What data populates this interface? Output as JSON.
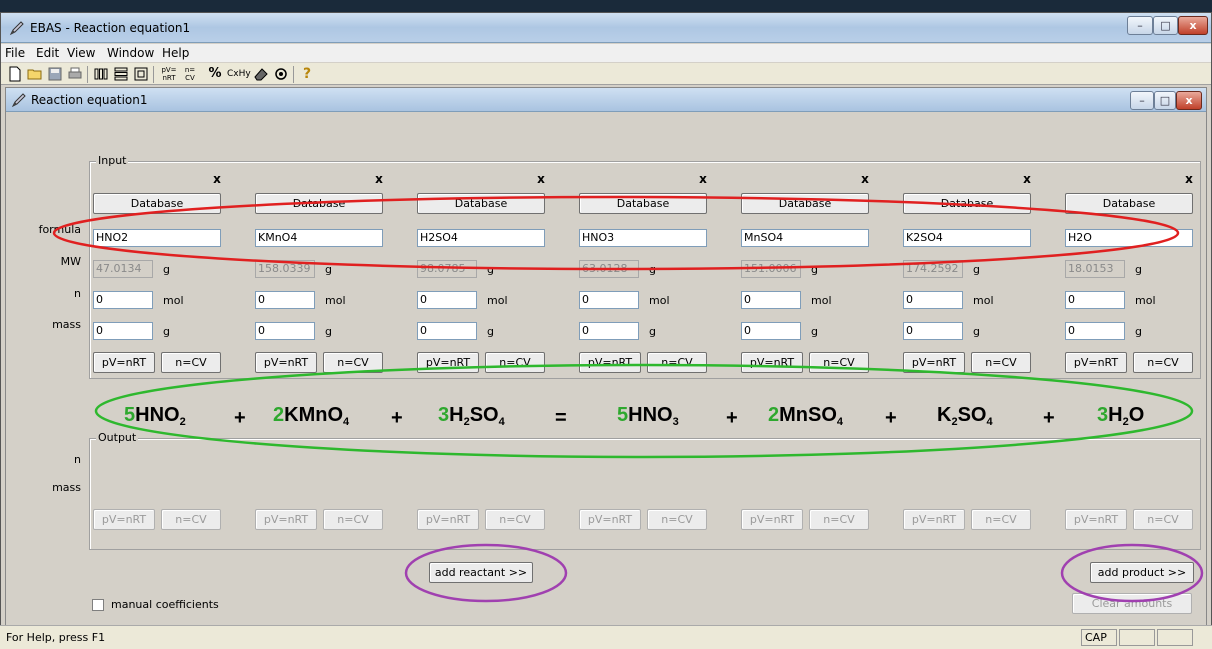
{
  "window": {
    "title": "EBAS - Reaction equation1"
  },
  "menu": [
    "File",
    "Edit",
    "View",
    "Window",
    "Help"
  ],
  "toolbar_icons": [
    "new-file-icon",
    "open-folder-icon",
    "save-icon",
    "print-icon",
    "columns-icon",
    "rows-icon",
    "window-icon",
    "pv-nrt-icon",
    "n-cv-icon",
    "percent-icon",
    "cxhy-icon",
    "eraser-icon",
    "gear-icon",
    "help-icon"
  ],
  "toolbar_text": {
    "pvnrt": "pV= nRT",
    "ncv": "n= CV",
    "percent": "%",
    "cxhy": "CxHy",
    "help": "?"
  },
  "child": {
    "title": "Reaction equation1"
  },
  "input": {
    "label": "Input",
    "row_labels": {
      "formula": "formula",
      "mw": "MW",
      "n": "n",
      "mass": "mass"
    },
    "db_label": "Database",
    "x_label": "x",
    "unit_g": "g",
    "unit_mol": "mol",
    "btn_pv": "pV=nRT",
    "btn_ncv": "n=CV",
    "columns": [
      {
        "formula": "HNO2",
        "mw": "47.0134",
        "n": "0",
        "mass": "0"
      },
      {
        "formula": "KMnO4",
        "mw": "158.0339",
        "n": "0",
        "mass": "0"
      },
      {
        "formula": "H2SO4",
        "mw": "98.0785",
        "n": "0",
        "mass": "0"
      },
      {
        "formula": "HNO3",
        "mw": "63.0128",
        "n": "0",
        "mass": "0"
      },
      {
        "formula": "MnSO4",
        "mw": "151.0006",
        "n": "0",
        "mass": "0"
      },
      {
        "formula": "K2SO4",
        "mw": "174.2592",
        "n": "0",
        "mass": "0"
      },
      {
        "formula": "H2O",
        "mw": "18.0153",
        "n": "0",
        "mass": "0"
      }
    ]
  },
  "equation": {
    "terms": [
      {
        "coef": "5",
        "parts": [
          "HNO",
          "2"
        ]
      },
      {
        "coef": "2",
        "parts": [
          "KMnO",
          "4"
        ]
      },
      {
        "coef": "3",
        "parts": [
          "H",
          "2",
          "SO",
          "4"
        ]
      },
      {
        "coef": "5",
        "parts": [
          "HNO",
          "3"
        ]
      },
      {
        "coef": "2",
        "parts": [
          "MnSO",
          "4"
        ]
      },
      {
        "coef": "",
        "parts": [
          "K",
          "2",
          "SO",
          "4"
        ]
      },
      {
        "coef": "3",
        "parts": [
          "H",
          "2",
          "O"
        ]
      }
    ],
    "operators": [
      "+",
      "+",
      "=",
      "+",
      "+",
      "+"
    ]
  },
  "output": {
    "label": "Output",
    "row_n": "n",
    "row_mass": "mass"
  },
  "buttons": {
    "add_reactant": "add reactant >>",
    "add_product": "add product >>",
    "clear_amounts": "Clear amounts"
  },
  "manual_coefficients": "manual coefficients",
  "status": {
    "help": "For Help, press F1",
    "cap": "CAP"
  },
  "colors": {
    "coefficient": "#2ea82e",
    "red_annotation": "#e02020",
    "green_annotation": "#2eb82e",
    "purple_annotation": "#a040b0"
  }
}
